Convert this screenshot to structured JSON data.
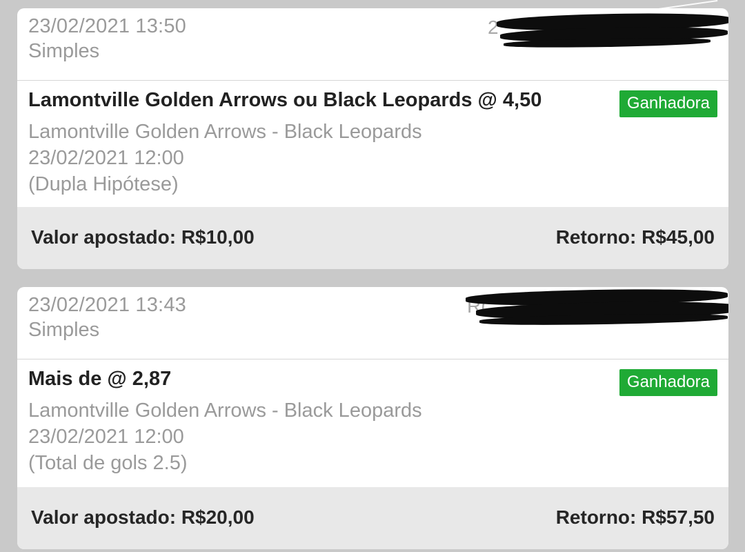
{
  "bets": [
    {
      "placed_at": "23/02/2021 13:50",
      "bet_type": "Simples",
      "ref_partial": "2",
      "selection": "Lamontville Golden Arrows ou Black Leopards @ 4,50",
      "status": "Ganhadora",
      "event": "Lamontville Golden Arrows - Black Leopards",
      "event_time": "23/02/2021 12:00",
      "market": "(Dupla Hipótese)",
      "stake": "Valor apostado: R$10,00",
      "payout": "Retorno: R$45,00"
    },
    {
      "placed_at": "23/02/2021 13:43",
      "bet_type": "Simples",
      "ref_partial": "R(",
      "selection": "Mais de @ 2,87",
      "status": "Ganhadora",
      "event": "Lamontville Golden Arrows - Black Leopards",
      "event_time": "23/02/2021 12:00",
      "market": "(Total de gols 2.5)",
      "stake": "Valor apostado: R$20,00",
      "payout": "Retorno: R$57,50"
    }
  ],
  "colors": {
    "status_green": "#1faa35",
    "background": "#c9c9c9",
    "footer": "#e8e8e8"
  }
}
